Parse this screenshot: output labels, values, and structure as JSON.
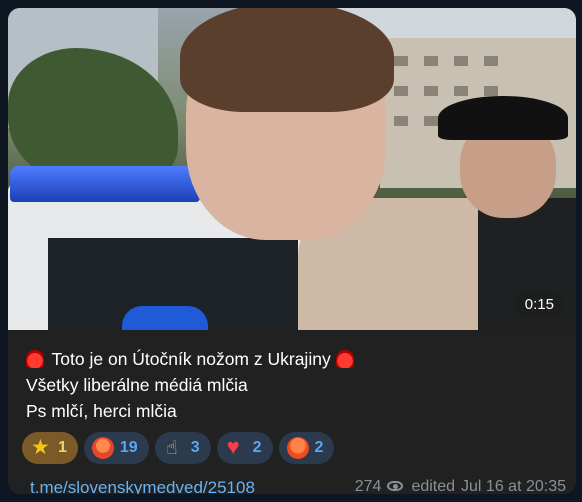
{
  "post": {
    "video": {
      "duration": "0:15"
    },
    "text_lines": [
      "Toto je on Útočník nožom z Ukrajiny",
      "Všetky liberálne médiá mlčia",
      "Ps mlčí, herci mlčia"
    ],
    "reactions": [
      {
        "icon": "star-icon",
        "count": "1",
        "selected": true
      },
      {
        "icon": "angry-face-icon",
        "count": "19"
      },
      {
        "icon": "middle-finger-icon",
        "count": "3"
      },
      {
        "icon": "heart-icon",
        "count": "2"
      },
      {
        "icon": "pouting-face-icon",
        "count": "2"
      }
    ],
    "link": "t.me/slovenskymedved/25108",
    "views": "274",
    "edited_label": "edited",
    "date": "Jul 16 at 20:35"
  },
  "colors": {
    "background": "#0e1621",
    "card": "#212121",
    "link": "#6ab3f3",
    "reaction_bg": "#2b3a4d",
    "reaction_selected_bg": "#7a5a28"
  }
}
